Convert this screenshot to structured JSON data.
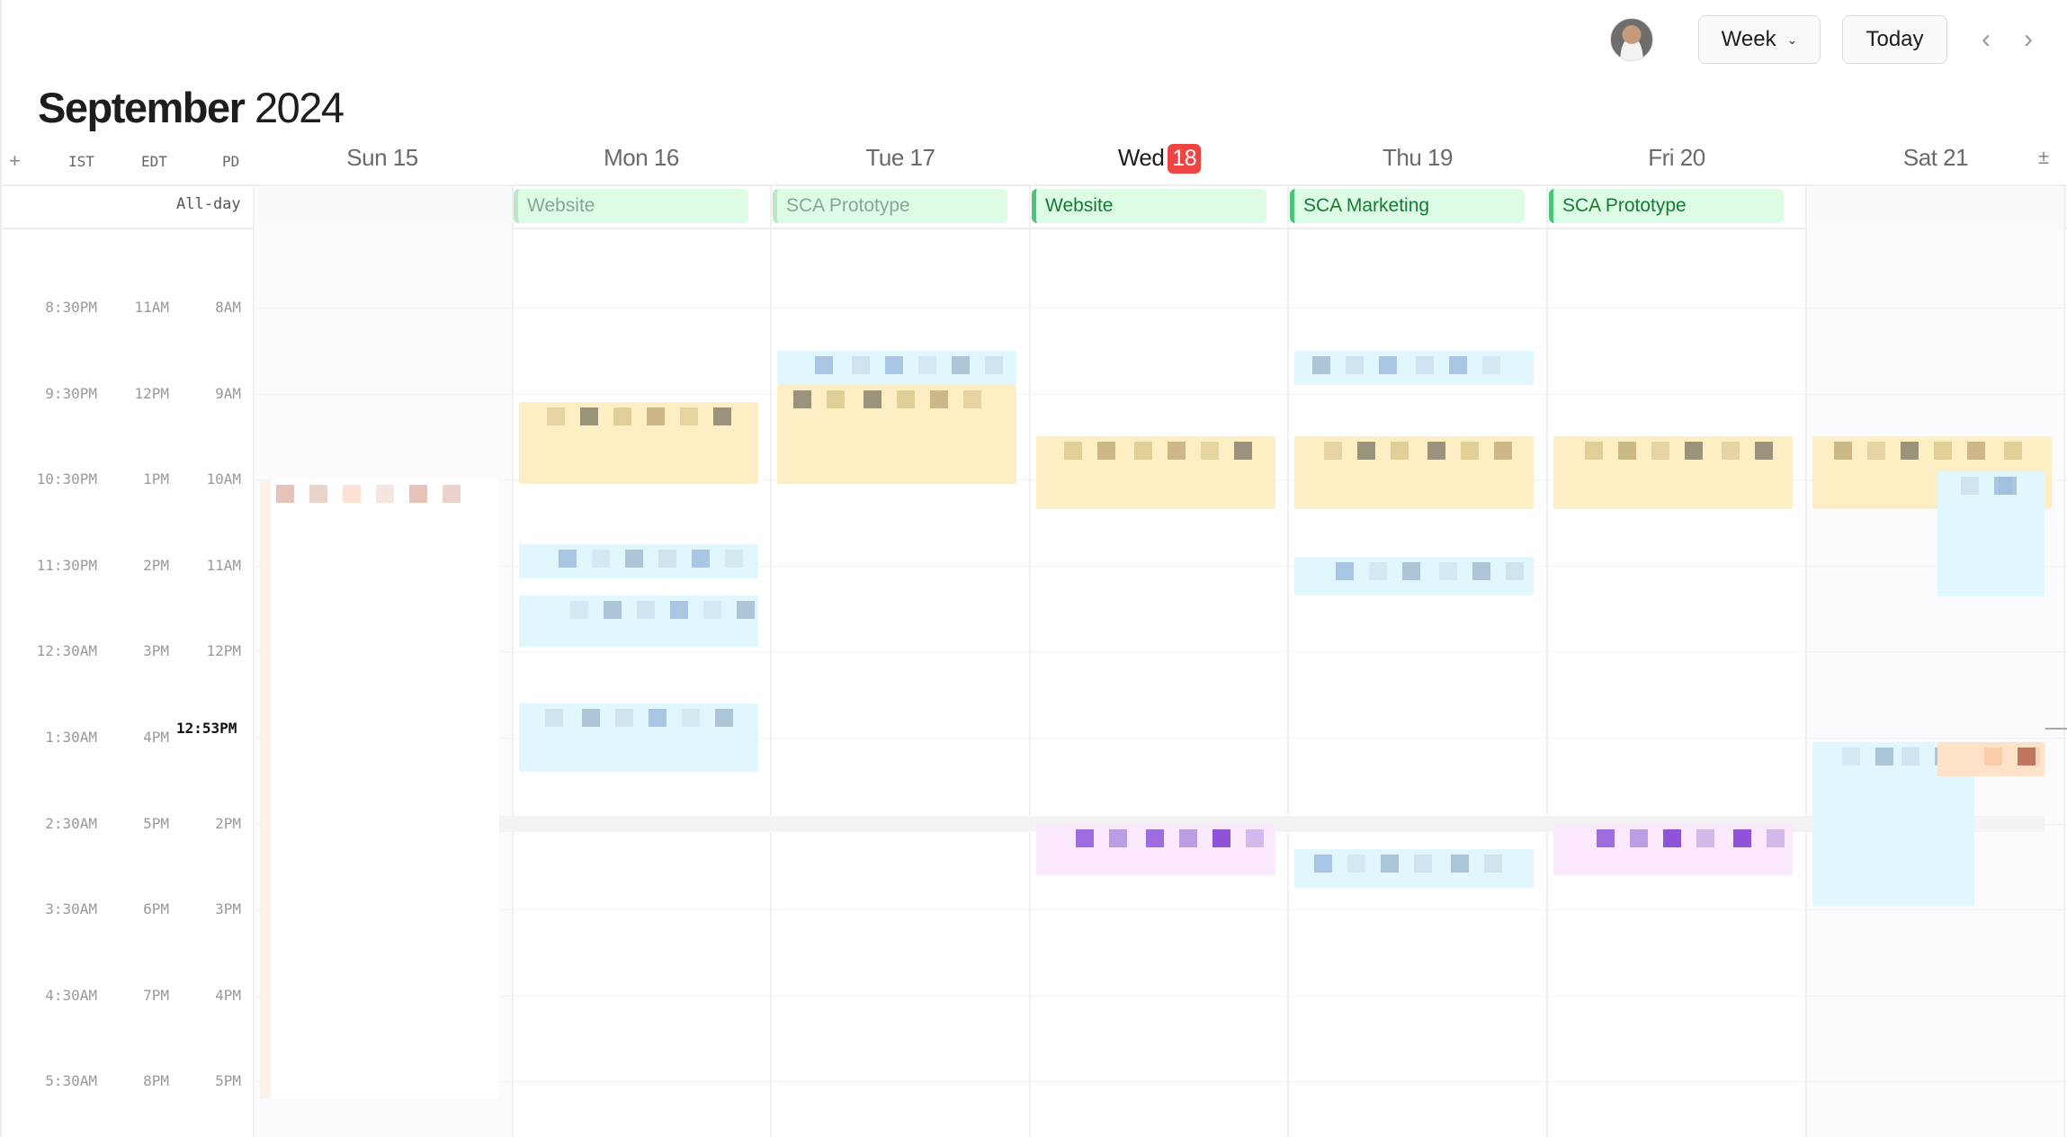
{
  "toolbar": {
    "avatar_alt": "User avatar",
    "view_select": "Week",
    "today_label": "Today",
    "prev_icon": "‹",
    "next_icon": "›",
    "chevron_icon": "⌄"
  },
  "title": {
    "month": "September",
    "year": "2024"
  },
  "header": {
    "add_icon": "+",
    "timezones": [
      "IST",
      "EDT",
      "PD"
    ],
    "adjust_icon": "±",
    "days": [
      {
        "label": "Sun 15",
        "today": false
      },
      {
        "label": "Mon 16",
        "today": false
      },
      {
        "label": "Tue 17",
        "today": false
      },
      {
        "label": "Wed",
        "badge": "18",
        "today": true
      },
      {
        "label": "Thu 19",
        "today": false
      },
      {
        "label": "Fri 20",
        "today": false
      },
      {
        "label": "Sat 21",
        "today": false
      }
    ]
  },
  "allday": {
    "label": "All-day",
    "events": [
      {
        "day": "Mon 16",
        "title": "Website",
        "past": true
      },
      {
        "day": "Tue 17",
        "title": "SCA Prototype",
        "past": true
      },
      {
        "day": "Wed 18",
        "title": "Website",
        "past": false
      },
      {
        "day": "Thu 19",
        "title": "SCA Marketing",
        "past": false
      },
      {
        "day": "Fri 20",
        "title": "SCA Prototype",
        "past": false
      }
    ]
  },
  "time_rows": [
    [
      "8:30PM",
      "11AM",
      "8AM"
    ],
    [
      "9:30PM",
      "12PM",
      "9AM"
    ],
    [
      "10:30PM",
      "1PM",
      "10AM"
    ],
    [
      "11:30PM",
      "2PM",
      "11AM"
    ],
    [
      "12:30AM",
      "3PM",
      "12PM"
    ],
    [
      "1:30AM",
      "4PM",
      ""
    ],
    [
      "2:30AM",
      "5PM",
      "2PM"
    ],
    [
      "3:30AM",
      "6PM",
      "3PM"
    ],
    [
      "4:30AM",
      "7PM",
      "4PM"
    ],
    [
      "5:30AM",
      "8PM",
      "5PM"
    ]
  ],
  "current_time": "12:53PM",
  "colors": {
    "today_badge": "#ef4444",
    "allday_bg": "#dcfce5",
    "allday_accent": "#4cc47a",
    "event_yellow": "#fdefc3",
    "event_blue": "#e0f7fd",
    "event_purple": "#fbeafd",
    "event_peach": "#fde2c9"
  },
  "events": [
    {
      "day": 0,
      "color": "white",
      "start": 10.0,
      "end": 17.2,
      "note": "obscured"
    },
    {
      "day": 1,
      "color": "yellow",
      "start": 9.1,
      "end": 10.05,
      "note": "obscured"
    },
    {
      "day": 1,
      "color": "blue",
      "start": 10.75,
      "end": 11.15,
      "note": "obscured"
    },
    {
      "day": 1,
      "color": "blue",
      "start": 11.35,
      "end": 11.95,
      "note": "obscured"
    },
    {
      "day": 1,
      "color": "blue",
      "start": 12.6,
      "end": 13.4,
      "note": "obscured"
    },
    {
      "day": 2,
      "color": "blue",
      "start": 8.5,
      "end": 8.9,
      "note": "obscured"
    },
    {
      "day": 2,
      "color": "yellow",
      "start": 8.9,
      "end": 10.05,
      "note": "obscured"
    },
    {
      "day": 3,
      "color": "yellow",
      "start": 9.5,
      "end": 10.35,
      "note": "obscured"
    },
    {
      "day": 3,
      "color": "purple",
      "start": 14.0,
      "end": 14.6,
      "note": "obscured"
    },
    {
      "day": 4,
      "color": "blue",
      "start": 8.5,
      "end": 8.9,
      "note": "obscured"
    },
    {
      "day": 4,
      "color": "yellow",
      "start": 9.5,
      "end": 10.35,
      "note": "obscured"
    },
    {
      "day": 4,
      "color": "blue",
      "start": 10.9,
      "end": 11.35,
      "note": "obscured"
    },
    {
      "day": 4,
      "color": "blue",
      "start": 14.3,
      "end": 14.75,
      "note": "obscured"
    },
    {
      "day": 5,
      "color": "yellow",
      "start": 9.5,
      "end": 10.35,
      "note": "obscured"
    },
    {
      "day": 5,
      "color": "purple",
      "start": 14.0,
      "end": 14.6,
      "note": "obscured"
    },
    {
      "day": 6,
      "color": "yellow",
      "start": 9.5,
      "end": 10.35,
      "note": "obscured"
    },
    {
      "day": 6,
      "color": "blue",
      "start": 9.9,
      "end": 11.35,
      "note": "obscured",
      "half": "right"
    },
    {
      "day": 6,
      "color": "blue",
      "start": 13.05,
      "end": 14.95,
      "note": "obscured",
      "half": "left"
    },
    {
      "day": 6,
      "color": "peach",
      "start": 13.05,
      "end": 13.45,
      "note": "obscured",
      "half": "right"
    }
  ]
}
